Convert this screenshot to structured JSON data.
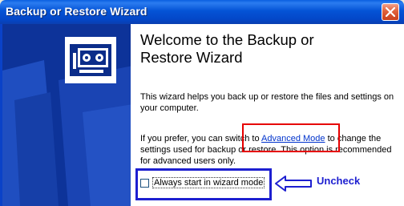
{
  "window": {
    "title": "Backup or Restore Wizard"
  },
  "icons": {
    "close": "close-icon",
    "backup": "backup-tape-icon",
    "arrow": "left-arrow-icon"
  },
  "content": {
    "heading_line1": "Welcome to the Backup or",
    "heading_line2": "Restore Wizard",
    "paragraph1": "This wizard helps you back up or restore the files and settings on your computer.",
    "paragraph2_before": "If you prefer, you can switch to ",
    "advanced_mode_link": "Advanced Mode",
    "paragraph2_after": " to change the settings used for backup or restore. This option is recommended for advanced users only.",
    "checkbox_label": "Always start in wizard mode",
    "checkbox_checked": false
  },
  "annotation": {
    "label": "Uncheck",
    "highlight_red": "#e60000",
    "highlight_blue": "#1d1fd0"
  }
}
